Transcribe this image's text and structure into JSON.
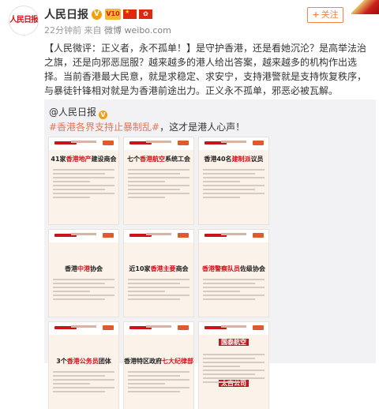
{
  "user": {
    "avatar_text": "人民日报",
    "name": "人民日报",
    "verified_symbol": "V",
    "badge_text": "V10",
    "flag_hk_text": "HK"
  },
  "meta": {
    "time": "22分钟前",
    "from_label": "来自",
    "source": "微博 weibo.com"
  },
  "follow": {
    "plus": "+",
    "label": "关注"
  },
  "post": {
    "text": "【人民微评：正义者，永不孤单！】是守护香港，还是看她沉沦？是高举法治之旗，还是向邪恶屈服？越来越多的港人给出答案，越来越多的机构作出选择。当前香港最大民意，就是求稳定、求安宁，支持港警就是支持恢复秩序，与暴徒针锋相对就是为香港前途出力。正义永不孤单，邪恶必被瓦解。"
  },
  "repost": {
    "author": "@人民日报",
    "verified_symbol": "V",
    "hashtag": "#香港各界支持止暴制乱#",
    "text_after": "，这才是港人心声！"
  },
  "cards": [
    {
      "pre": "41家",
      "hl": "香港地产",
      "post": "建设商会",
      "style": "plain",
      "pos": "top"
    },
    {
      "pre": "七个",
      "hl": "香港航空",
      "post": "系统工会",
      "style": "plain",
      "pos": "top"
    },
    {
      "pre": "香港40名",
      "hl": "建制派",
      "post": "议员",
      "style": "plain",
      "pos": "top"
    },
    {
      "pre": "香港",
      "hl": "中港",
      "post": "协会",
      "style": "plain",
      "pos": "low"
    },
    {
      "pre": "近10家",
      "hl": "香港主要",
      "post": "商会",
      "style": "plain",
      "pos": "low"
    },
    {
      "pre": "",
      "hl": "香港警察队员",
      "post": "佐级协会",
      "style": "plain",
      "pos": "low"
    },
    {
      "pre": "3个",
      "hl": "香港公务员",
      "post": "团体",
      "style": "plain",
      "pos": "low"
    },
    {
      "pre": "香港特区政府",
      "hl": "七大纪律部队",
      "post": "首长",
      "style": "plain",
      "pos": "low"
    },
    {
      "pre": "",
      "hl": "",
      "post": "国泰航空",
      "style": "red",
      "pos": "top",
      "second": "太古公司"
    }
  ]
}
